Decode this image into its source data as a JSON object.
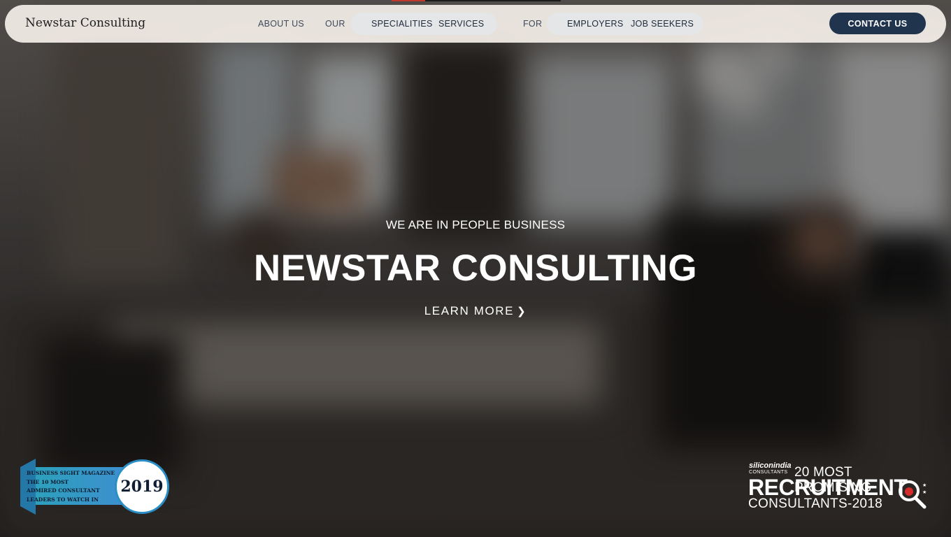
{
  "brand": {
    "name": "Newstar Consulting"
  },
  "nav": {
    "about": "ABOUT US",
    "our": "OUR",
    "specialities": "SPECIALITIES",
    "services": "SERVICES",
    "for": "FOR",
    "employers": "EMPLOYERS",
    "job_seekers": "JOB SEEKERS",
    "contact": "CONTACT US"
  },
  "hero": {
    "tagline": "WE ARE IN PEOPLE BUSINESS",
    "title": "NEWSTAR CONSULTING",
    "cta": "LEARN MORE",
    "cta_icon": "chevron-right-icon"
  },
  "awards": {
    "left": {
      "lines": [
        "BUSINESS SIGHT MAGAZINE",
        "THE 10 MOST",
        "ADMIRED CONSULTANT",
        "LEADERS TO WATCH IN"
      ],
      "year": "2019"
    },
    "right": {
      "logo": "siliconindia",
      "logo_sub": "CONSULTANTS",
      "line1": "20 MOST PROMISING",
      "line2": "RECRUITMENT",
      "line3": "CONSULTANTS-2018",
      "icon": "magnifier-icon"
    }
  },
  "colors": {
    "nav_bg": "#f4eee8",
    "contact_bg": "#20344e",
    "pill_bg": "#e4e6e8",
    "award_teal": "#2aa3b9"
  }
}
